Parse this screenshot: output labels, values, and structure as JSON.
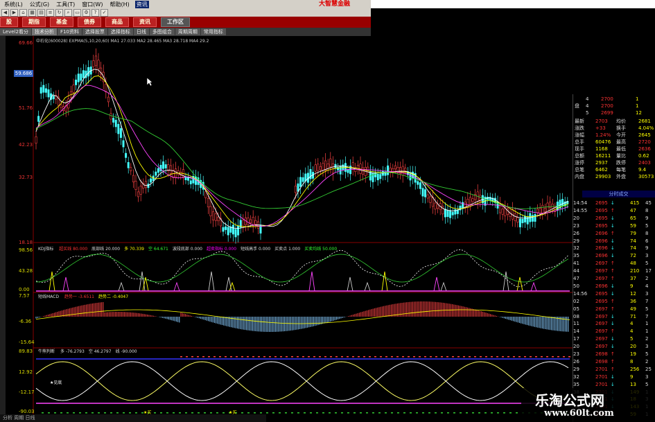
{
  "menu": {
    "items": [
      "系统(L)",
      "公式(G)",
      "工具(T)",
      "窗口(W)",
      "帮助(H)",
      "资讯"
    ],
    "highlight_index": 5
  },
  "brand": {
    "text": "大智慧金融"
  },
  "nav": {
    "buttons": [
      "股",
      "期指",
      "基金",
      "债券",
      "商品",
      "资讯"
    ],
    "workspace": "工作区"
  },
  "tabs": [
    "Level2看分",
    "技术分析",
    "F10资料",
    "选择股票",
    "选择指标",
    "日线",
    "多图组合",
    "周期周期",
    "常用指标"
  ],
  "main_chart": {
    "info": "中石化(600028) EXPMA(5,10,20,60) MA1 27.033  MA2 28.465  MA3 28.718  MA4 29.2",
    "price_tag": "59.686",
    "y_labels": [
      "69.66",
      "51.76",
      "42.23",
      "32.73",
      "18.18"
    ]
  },
  "kdj_panel": {
    "label_name": "KDJ指标",
    "items": [
      {
        "t": "超买线",
        "v": "80.000",
        "c": "r"
      },
      {
        "t": "底部线",
        "v": "20.000",
        "c": ""
      },
      {
        "t": "多",
        "v": "70.339",
        "c": "y"
      },
      {
        "t": "空",
        "v": "64.671",
        "c": "g"
      },
      {
        "t": "波段底部",
        "v": "0.000",
        "c": ""
      },
      {
        "t": "超卖指标",
        "v": "0.000",
        "c": "m"
      },
      {
        "t": "短线高手",
        "v": "0.000",
        "c": ""
      },
      {
        "t": "买卖点",
        "v": "1.000",
        "c": ""
      },
      {
        "t": "买卖均线",
        "v": "50.000",
        "c": "g"
      }
    ],
    "y_labels": [
      "98.56",
      "43.28",
      "0.00"
    ]
  },
  "macd_panel": {
    "label_name": "短线MACD",
    "items": [
      {
        "t": "趋势一",
        "v": "-3.6511",
        "c": "r"
      },
      {
        "t": "趋势二",
        "v": "-0.4047",
        "c": "y"
      }
    ],
    "y_labels": [
      "7.57",
      "-6.36",
      "-15.64"
    ]
  },
  "osc_panel": {
    "label_name": "牛熊判断",
    "items": [
      {
        "t": "多",
        "v": "-76.2793",
        "c": ""
      },
      {
        "t": "空",
        "v": "46.2797",
        "c": ""
      },
      {
        "t": "线",
        "v": "-90.000",
        "c": ""
      }
    ],
    "y_labels": [
      "89.83",
      "12.92",
      "-12.17",
      "-90.03"
    ],
    "markers": [
      "★见底",
      "★买",
      "★买"
    ]
  },
  "quote_panel": {
    "order_rows": [
      {
        "l": "",
        "n": "4",
        "p": "2700",
        "v": "1",
        "pc": "r"
      },
      {
        "l": "盘",
        "n": "4",
        "p": "2700",
        "v": "1",
        "pc": "r"
      },
      {
        "l": "",
        "n": "5",
        "p": "2699",
        "v": "12",
        "pc": "r"
      }
    ],
    "stats": [
      {
        "a": "最新",
        "b": "2703",
        "c": "均价",
        "d": "2681"
      },
      {
        "a": "涨跌",
        "b": "+33",
        "c": "换手",
        "d": "4.04%"
      },
      {
        "a": "涨幅",
        "b": "1.24%",
        "c": "今开",
        "d": "2645"
      },
      {
        "a": "总手",
        "b": "60476",
        "c": "最高",
        "d": "2720"
      },
      {
        "a": "现手",
        "b": "1168",
        "c": "最低",
        "d": "2636"
      },
      {
        "a": "总额",
        "b": "16211",
        "c": "量比",
        "d": "0.62"
      },
      {
        "a": "涨停",
        "b": "2937",
        "c": "跌停",
        "d": "2403"
      },
      {
        "a": "总笔",
        "b": "6462",
        "c": "每笔",
        "d": "9.4"
      },
      {
        "a": "内盘",
        "b": "29903",
        "c": "外盘",
        "d": "30573"
      }
    ],
    "band_label": "分时成交",
    "ticks": [
      {
        "t": "14:54",
        "p": "2695",
        "d": "↓",
        "v": "415",
        "n": "45"
      },
      {
        "t": "14:55",
        "p": "2695",
        "d": "↑",
        "v": "47",
        "n": "8"
      },
      {
        "t": "20",
        "p": "2695",
        "d": "↓",
        "v": "65",
        "n": "9"
      },
      {
        "t": "23",
        "p": "2695",
        "d": "↓",
        "v": "59",
        "n": "5"
      },
      {
        "t": "26",
        "p": "2696",
        "d": "↑",
        "v": "79",
        "n": "8"
      },
      {
        "t": "29",
        "p": "2696",
        "d": "↓",
        "v": "74",
        "n": "6"
      },
      {
        "t": "32",
        "p": "2696",
        "d": "↓",
        "v": "74",
        "n": "9"
      },
      {
        "t": "35",
        "p": "2696",
        "d": "↓",
        "v": "72",
        "n": "3"
      },
      {
        "t": "41",
        "p": "2697",
        "d": "↑",
        "v": "48",
        "n": "5"
      },
      {
        "t": "44",
        "p": "2697",
        "d": "↑",
        "v": "210",
        "n": "17"
      },
      {
        "t": "47",
        "p": "2697",
        "d": "↑",
        "v": "37",
        "n": "2"
      },
      {
        "t": "50",
        "p": "2696",
        "d": "↓",
        "v": "9",
        "n": "4"
      },
      {
        "t": "14:56",
        "p": "2695",
        "d": "↓",
        "v": "12",
        "n": "3"
      },
      {
        "t": "02",
        "p": "2695",
        "d": "↑",
        "v": "36",
        "n": "7"
      },
      {
        "t": "05",
        "p": "2697",
        "d": "↑",
        "v": "49",
        "n": "5"
      },
      {
        "t": "08",
        "p": "2697",
        "d": "↓",
        "v": "71",
        "n": "7"
      },
      {
        "t": "11",
        "p": "2697",
        "d": "↓",
        "v": "4",
        "n": "1"
      },
      {
        "t": "14",
        "p": "2697",
        "d": "↑",
        "v": "4",
        "n": "1"
      },
      {
        "t": "17",
        "p": "2697",
        "d": "↓",
        "v": "5",
        "n": "2"
      },
      {
        "t": "20",
        "p": "2697",
        "d": "↓",
        "v": "20",
        "n": "3"
      },
      {
        "t": "23",
        "p": "2698",
        "d": "↑",
        "v": "19",
        "n": "5"
      },
      {
        "t": "26",
        "p": "2698",
        "d": "↑",
        "v": "8",
        "n": "2"
      },
      {
        "t": "29",
        "p": "2701",
        "d": "↑",
        "v": "256",
        "n": "25"
      },
      {
        "t": "32",
        "p": "2701",
        "d": "↓",
        "v": "9",
        "n": "3"
      },
      {
        "t": "35",
        "p": "2701",
        "d": "↓",
        "v": "13",
        "n": "5"
      },
      {
        "t": "38",
        "p": "2701",
        "d": "↓",
        "v": "149",
        "n": "1"
      },
      {
        "t": "41",
        "p": "2701",
        "d": "↓",
        "v": "18",
        "n": "3"
      },
      {
        "t": "30",
        "p": "2701",
        "d": "↓",
        "v": "143",
        "n": "1"
      },
      {
        "t": "41",
        "p": "2701",
        "d": "↓",
        "v": "59",
        "n": "1"
      }
    ]
  },
  "watermark": {
    "line1": "乐淘公式网",
    "line2": "www.60lt.com"
  },
  "status": {
    "text": "分析 周期 日线"
  },
  "colors": {
    "up": "#ff3333",
    "down": "#33ffff",
    "accent": "#ffff00"
  }
}
